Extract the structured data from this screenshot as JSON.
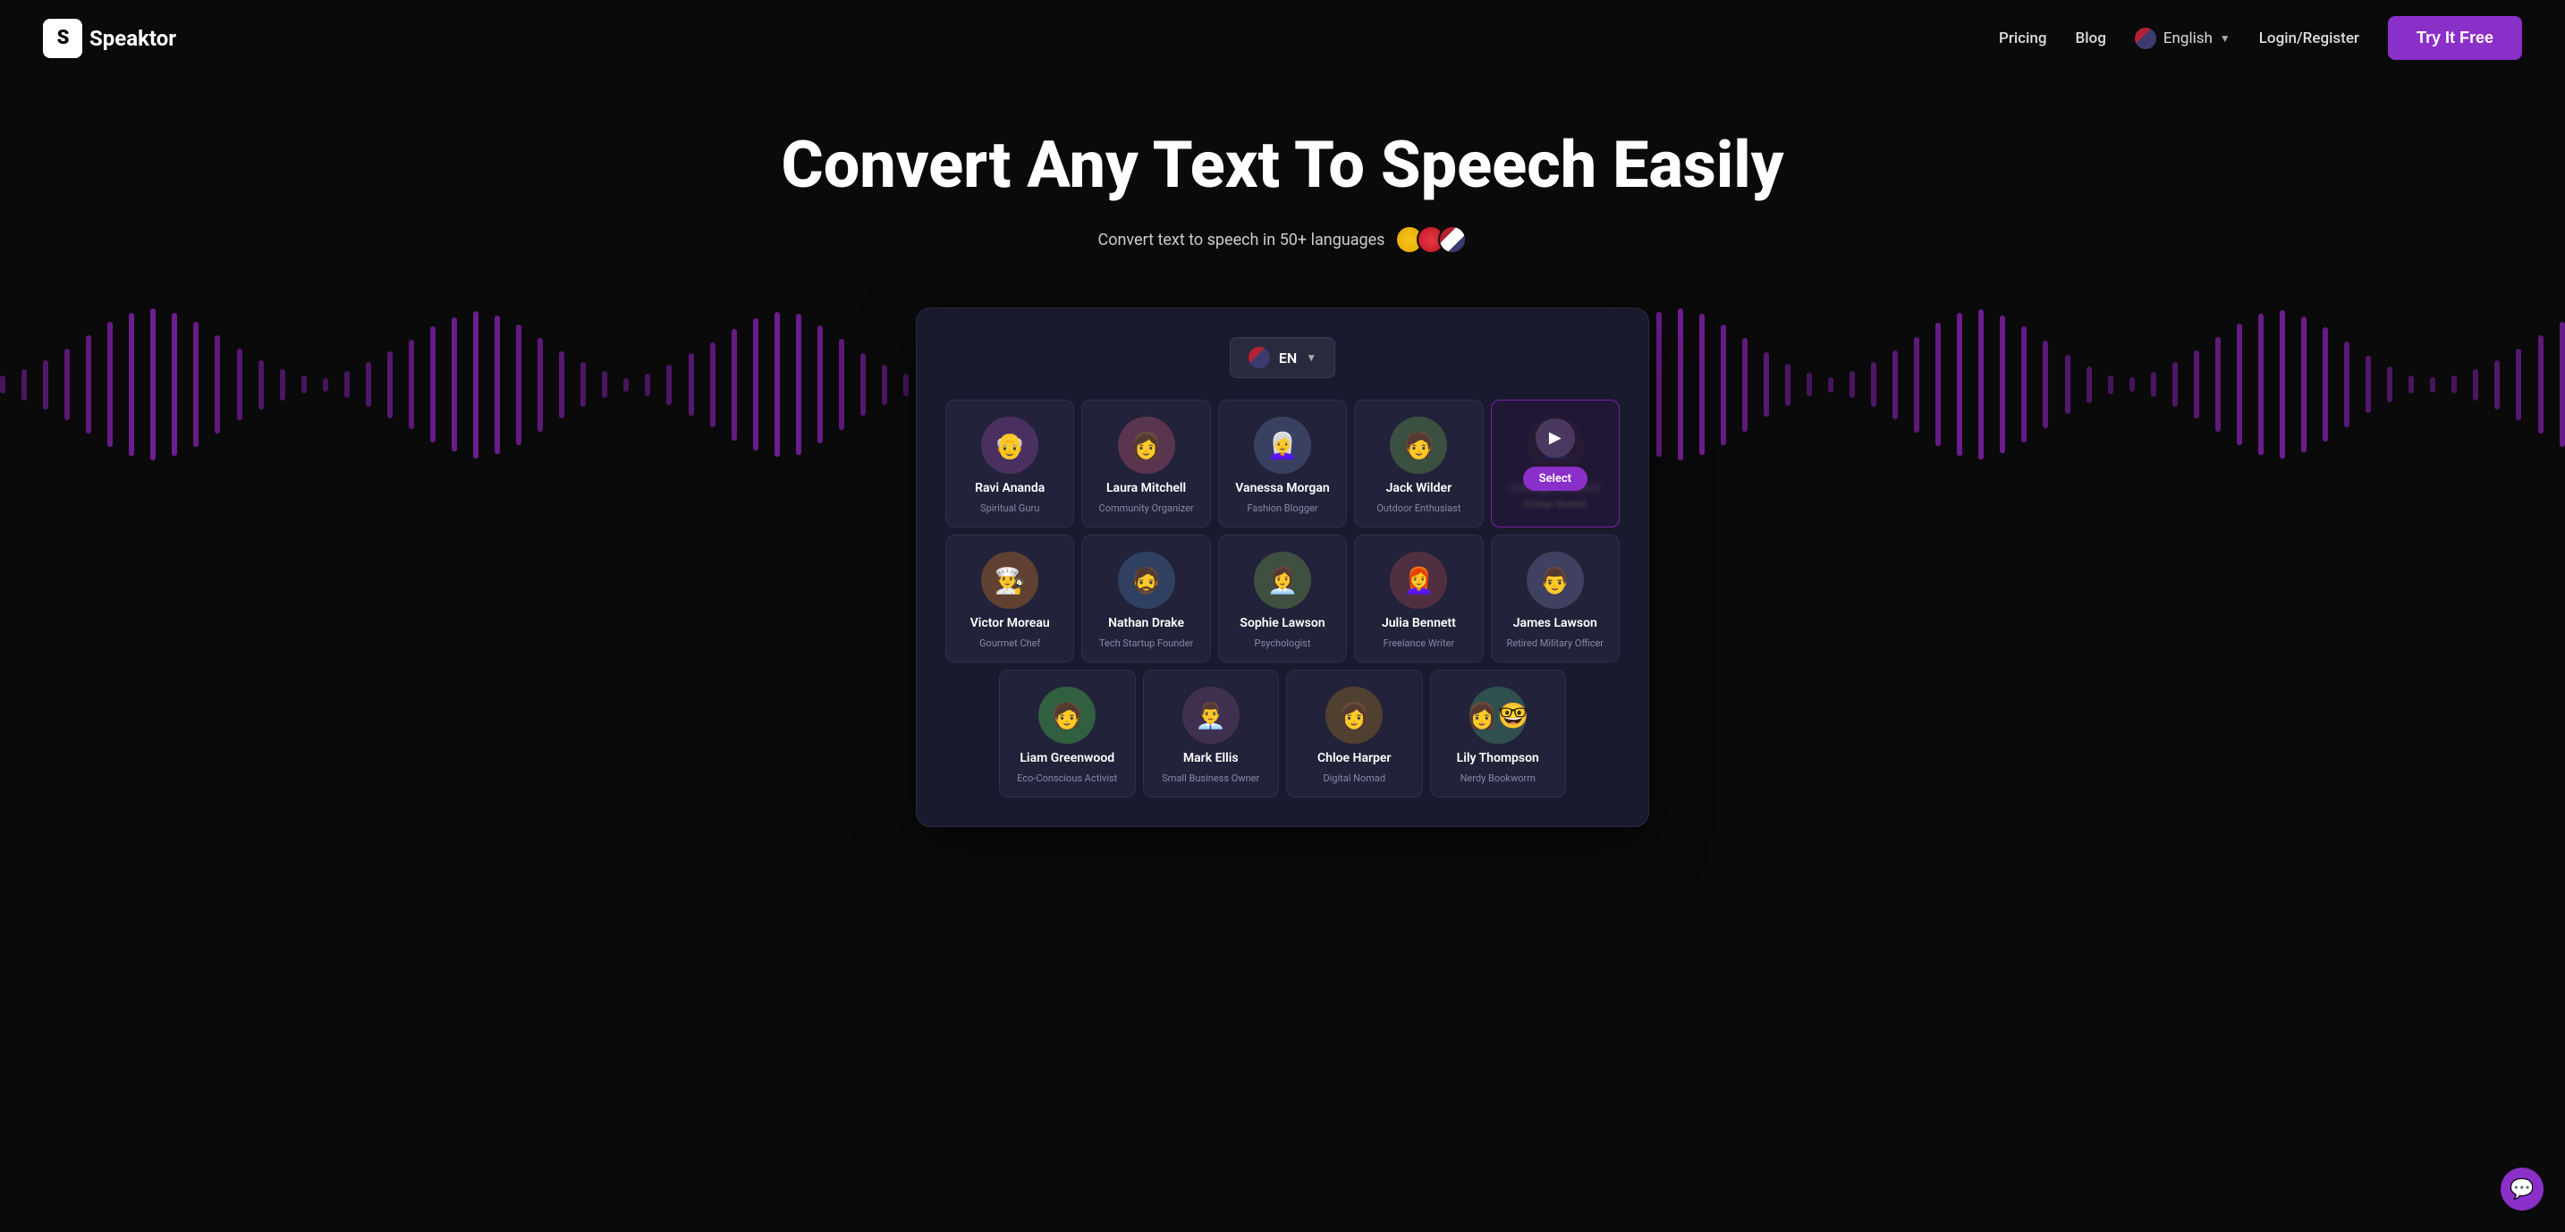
{
  "nav": {
    "logo_letter": "S",
    "logo_name": "peaktor",
    "pricing_label": "Pricing",
    "blog_label": "Blog",
    "lang_label": "English",
    "login_label": "Login/Register",
    "try_label": "Try It Free"
  },
  "hero": {
    "title": "Convert Any Text To Speech Easily",
    "subtitle": "Convert text to speech in 50+ languages"
  },
  "app": {
    "lang_code": "EN",
    "voices_row1": [
      {
        "name": "Ravi Ananda",
        "title": "Spiritual Guru",
        "emoji": "👴"
      },
      {
        "name": "Laura Mitchell",
        "title": "Community Organizer",
        "emoji": "👩"
      },
      {
        "name": "Vanessa Morgan",
        "title": "Fashion Blogger",
        "emoji": "👩‍🦳"
      },
      {
        "name": "Jack Wilder",
        "title": "Outdoor Enthusiast",
        "emoji": "🧑"
      },
      {
        "name": "Select",
        "title": "College Student",
        "is_select": true,
        "emoji": "👤"
      }
    ],
    "voices_row2": [
      {
        "name": "Victor Moreau",
        "title": "Gourmet Chef",
        "emoji": "👨‍🍳"
      },
      {
        "name": "Nathan Drake",
        "title": "Tech Startup Founder",
        "emoji": "🧔"
      },
      {
        "name": "Sophie Lawson",
        "title": "Psychologist",
        "emoji": "👩‍💼"
      },
      {
        "name": "Julia Bennett",
        "title": "Freelance Writer",
        "emoji": "👩‍🦰"
      },
      {
        "name": "James Lawson",
        "title": "Retired Military Officer",
        "emoji": "👨"
      }
    ],
    "voices_row3": [
      {
        "name": "Liam Greenwood",
        "title": "Eco-Conscious Activist",
        "emoji": "🧑"
      },
      {
        "name": "Mark Ellis",
        "title": "Small Business Owner",
        "emoji": "👨‍💼"
      },
      {
        "name": "Chloe Harper",
        "title": "Digital Nomad",
        "emoji": "👩"
      },
      {
        "name": "Lily Thompson",
        "title": "Nerdy Bookworm",
        "emoji": "👩‍🤓"
      }
    ]
  },
  "chat": {
    "icon": "💬"
  }
}
